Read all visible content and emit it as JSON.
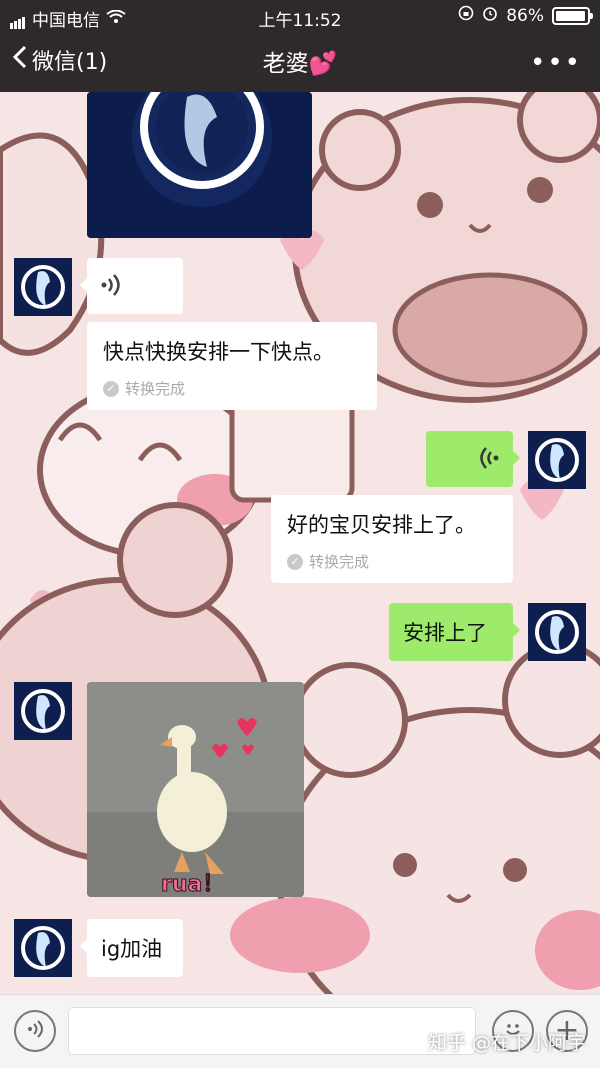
{
  "status_bar": {
    "carrier": "中国电信",
    "time": "上午11:52",
    "battery": "86%",
    "battery_level": 0.86
  },
  "nav": {
    "back_label": "微信(1)",
    "title": "老婆💕",
    "more_icon": "more-icon"
  },
  "messages": {
    "voice_in": {
      "icon": "voice-wave-icon"
    },
    "transcript_1": {
      "text": "快点快换安排一下快点。",
      "status": "转换完成"
    },
    "voice_out": {
      "icon": "voice-wave-icon"
    },
    "transcript_2": {
      "text": "好的宝贝安排上了。",
      "status": "转换完成"
    },
    "text_out": "安排上了",
    "sticker_caption": "rua！",
    "text_in": "ig加油"
  },
  "input_bar": {
    "voice_button_icon": "voice-icon",
    "emoji_button_icon": "emoji-icon",
    "plus_button_icon": "plus-icon"
  },
  "watermark": "知乎 @在下小阿宇",
  "colors": {
    "header_bg": "#2e2a2c",
    "bubble_green": "#9eea6a",
    "bubble_white": "#ffffff",
    "avatar_bg": "#0e1f4f"
  }
}
